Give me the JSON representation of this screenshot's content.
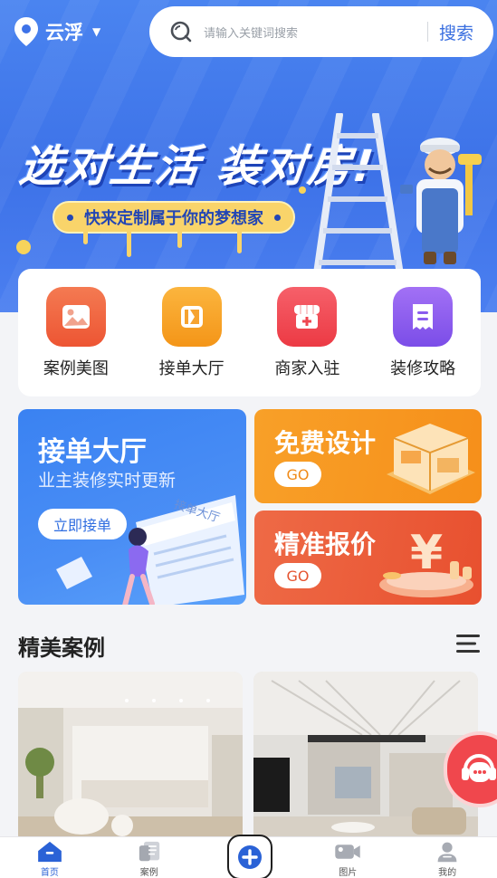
{
  "header": {
    "city": "云浮",
    "search_placeholder": "请输入关键词搜索",
    "search_button": "搜索"
  },
  "banner": {
    "slogan": "选对生活 装对房!",
    "pill": "快来定制属于你的梦想家"
  },
  "categories": [
    {
      "label": "案例美图",
      "icon": "image-icon",
      "color": "#f0603d"
    },
    {
      "label": "接单大厅",
      "icon": "bookmark-flag-icon",
      "color": "#f8a224"
    },
    {
      "label": "商家入驻",
      "icon": "store-icon",
      "color": "#f2474f"
    },
    {
      "label": "装修攻略",
      "icon": "receipt-icon",
      "color": "#8f5cf0"
    }
  ],
  "promos": {
    "order_hall": {
      "title": "接单大厅",
      "subtitle": "业主装修实时更新",
      "cta": "立即接单",
      "paper_text": "接单大厅"
    },
    "free_design": {
      "title": "免费设计",
      "cta": "GO"
    },
    "quote": {
      "title": "精准报价",
      "cta": "GO"
    }
  },
  "cases_section": {
    "title": "精美案例"
  },
  "tabbar": {
    "items": [
      {
        "label": "首页",
        "icon": "home-icon",
        "active": true
      },
      {
        "label": "案例",
        "icon": "cases-icon",
        "active": false
      },
      {
        "label": "",
        "icon": "add-icon",
        "active": false
      },
      {
        "label": "图片",
        "icon": "video-camera-icon",
        "active": false
      },
      {
        "label": "我的",
        "icon": "user-icon",
        "active": false
      }
    ]
  },
  "colors": {
    "brand_blue": "#3d72e8",
    "accent_orange": "#f89c22",
    "accent_red": "#ee5a3a"
  }
}
